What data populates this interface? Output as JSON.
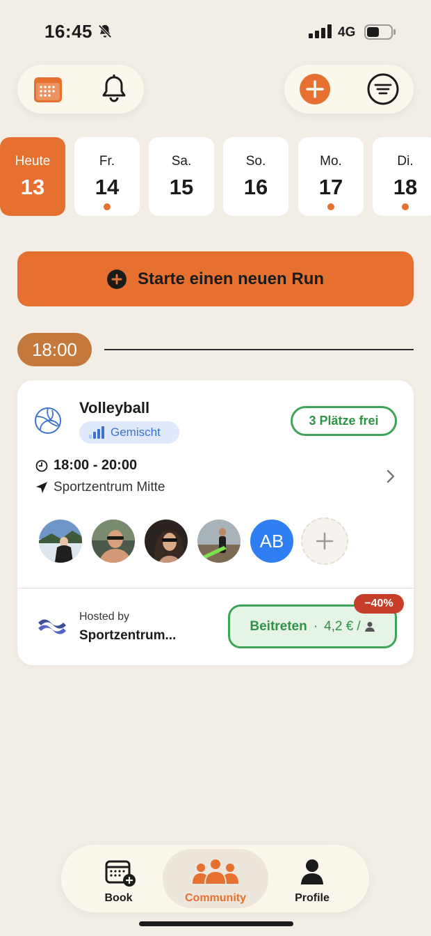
{
  "status_bar": {
    "time": "16:45",
    "network": "4G"
  },
  "colors": {
    "accent": "#e6702f",
    "background": "#f2eee6",
    "green": "#3ea356",
    "discount": "#c63d2a",
    "blue": "#2f7ff2"
  },
  "days": [
    {
      "name": "Heute",
      "num": "13",
      "active": true,
      "dot": false
    },
    {
      "name": "Fr.",
      "num": "14",
      "active": false,
      "dot": true
    },
    {
      "name": "Sa.",
      "num": "15",
      "active": false,
      "dot": false
    },
    {
      "name": "So.",
      "num": "16",
      "active": false,
      "dot": false
    },
    {
      "name": "Mo.",
      "num": "17",
      "active": false,
      "dot": true
    },
    {
      "name": "Di.",
      "num": "18",
      "active": false,
      "dot": true
    }
  ],
  "start_run": {
    "label": "Starte einen neuen Run"
  },
  "time_slot": "18:00",
  "event": {
    "title": "Volleyball",
    "level": "Gemischt",
    "slots": "3 Plätze frei",
    "time_range": "18:00 - 20:00",
    "location": "Sportzentrum Mitte",
    "avatar_initials": "AB",
    "hosted_by_label": "Hosted by",
    "host_name": "Sportzentrum...",
    "join_label": "Beitreten",
    "price": "4,2 €",
    "discount": "−40%"
  },
  "nav": {
    "book": "Book",
    "community": "Community",
    "profile": "Profile"
  }
}
